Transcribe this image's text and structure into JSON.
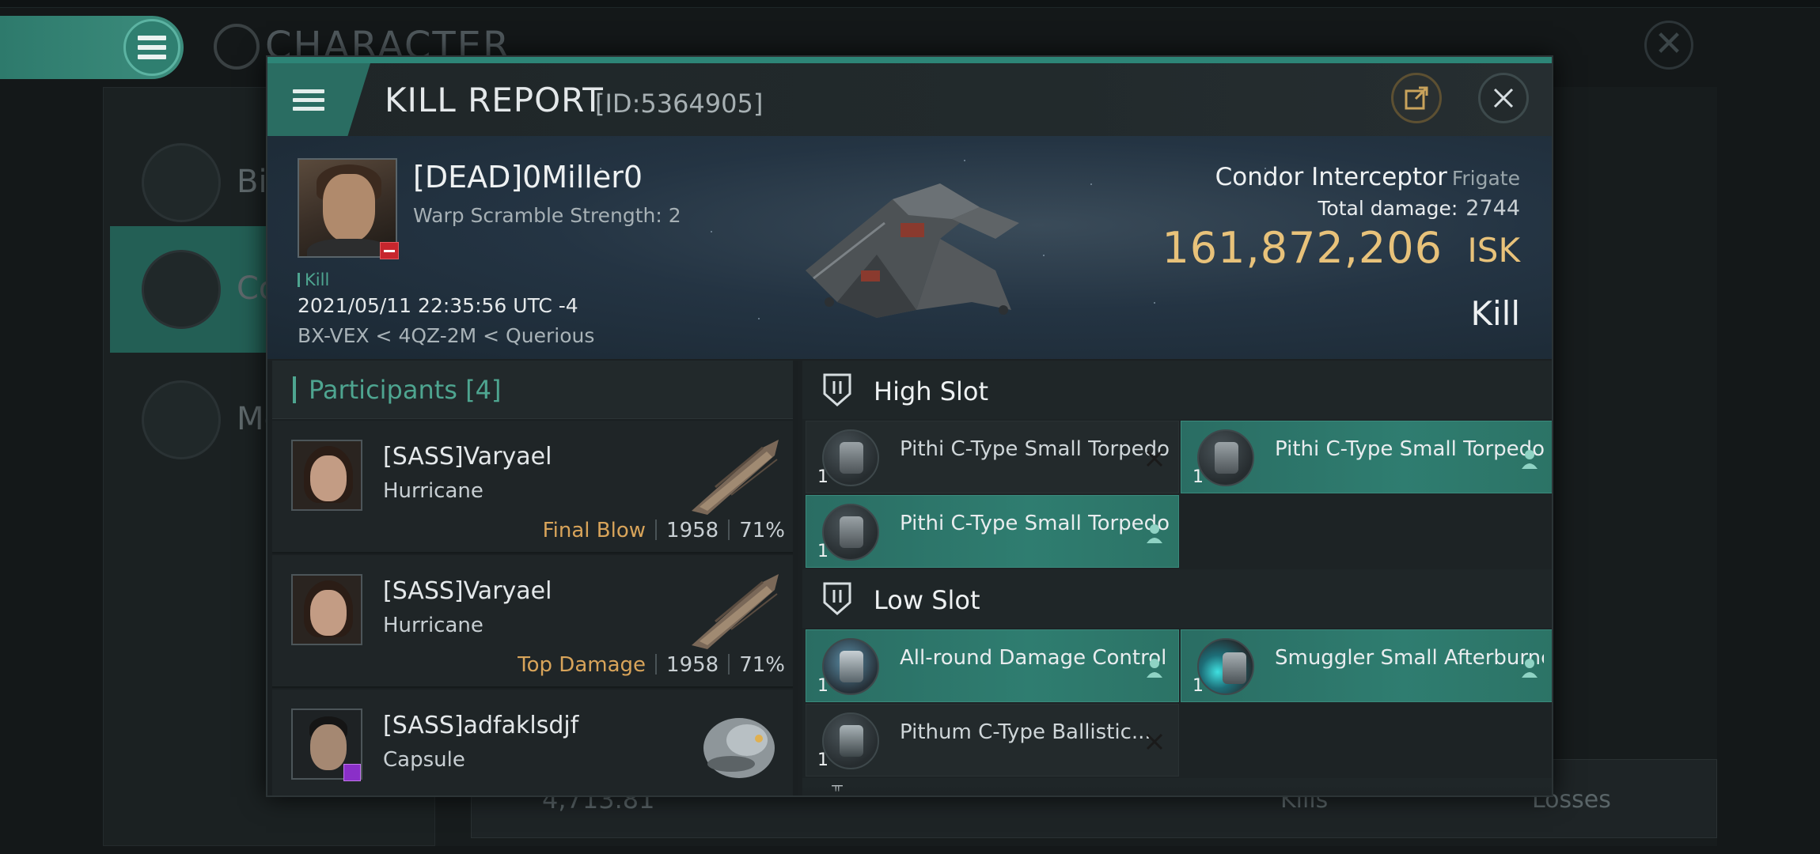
{
  "background": {
    "screen_title": "CHARACTER",
    "side_items": [
      {
        "label": "Bio",
        "icon": "list-icon"
      },
      {
        "label": "Co",
        "icon": "combat-icon"
      },
      {
        "label": "Me",
        "icon": "medal-icon"
      }
    ],
    "bottom": {
      "number": "4,713.81",
      "kills_label": "Kills",
      "losses_label": "Losses"
    }
  },
  "dialog": {
    "title": "KILL REPORT",
    "id": "[ID:5364905]",
    "share_icon": "share-icon",
    "close_icon": "close-icon"
  },
  "victim": {
    "name": "[DEAD]0Miller0",
    "warp_scramble": "Warp Scramble Strength: 2",
    "tag": "Kill",
    "time": "2021/05/11 22:35:56 UTC -4",
    "location": "BX-VEX < 4QZ-2M < Querious",
    "ship_name": "Condor Interceptor",
    "ship_class": "Frigate",
    "total_damage_label": "Total damage:",
    "total_damage": "2744",
    "isk_value": "161,872,206",
    "isk_unit": "ISK",
    "result": "Kill"
  },
  "participants": {
    "title": "Participants [4]",
    "rows": [
      {
        "name": "[SASS]Varyael",
        "ship": "Hurricane",
        "tag": "Final Blow",
        "damage": "1958",
        "percent": "71%"
      },
      {
        "name": "[SASS]Varyael",
        "ship": "Hurricane",
        "tag": "Top Damage",
        "damage": "1958",
        "percent": "71%"
      },
      {
        "name": "[SASS]adfaklsdjf",
        "ship": "Capsule",
        "tag": "",
        "damage": "",
        "percent": ""
      }
    ]
  },
  "fittings": {
    "high_slot_label": "High Slot",
    "low_slot_label": "Low Slot",
    "high": [
      {
        "name": "Pithi C-Type Small Torpedo ...",
        "qty": "1",
        "state": "destroyed"
      },
      {
        "name": "Pithi C-Type Small Torpedo ...",
        "qty": "1",
        "state": "dropped"
      },
      {
        "name": "Pithi C-Type Small Torpedo ...",
        "qty": "1",
        "state": "dropped"
      }
    ],
    "low": [
      {
        "name": "All-round Damage Control",
        "qty": "1",
        "state": "dropped"
      },
      {
        "name": "Smuggler Small Afterburner",
        "qty": "1",
        "state": "dropped"
      },
      {
        "name": "Pithum C-Type Ballistic...",
        "qty": "1",
        "state": "destroyed"
      }
    ]
  },
  "colors": {
    "accent": "#2d8577",
    "isk": "#e8c27a",
    "final_blow": "#d8a45a"
  }
}
